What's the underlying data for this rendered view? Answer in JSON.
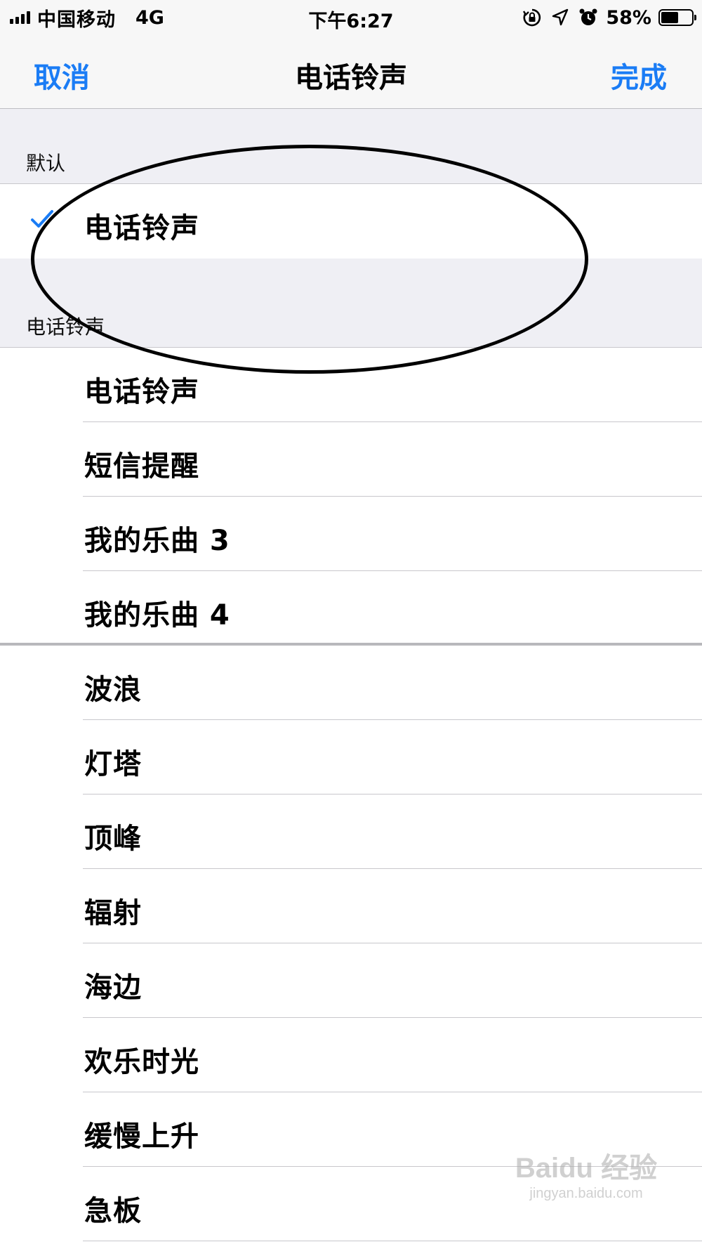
{
  "status_bar": {
    "carrier": "中国移动",
    "network": "4G",
    "time": "下午6:27",
    "battery_percent": "58%",
    "battery_level": 0.58,
    "icons": [
      "signal-icon",
      "rotation-lock-icon",
      "location-icon",
      "alarm-icon",
      "battery-icon"
    ]
  },
  "nav": {
    "cancel_label": "取消",
    "title": "电话铃声",
    "done_label": "完成"
  },
  "sections": {
    "default_header": "默认",
    "ringtones_header": "电话铃声"
  },
  "default_items": [
    {
      "label": "电话铃声",
      "selected": true
    }
  ],
  "ringtones": [
    {
      "label": "电话铃声"
    },
    {
      "label": "短信提醒"
    },
    {
      "label": "我的乐曲 3"
    },
    {
      "label": "我的乐曲 4"
    },
    {
      "label": "波浪"
    },
    {
      "label": "灯塔"
    },
    {
      "label": "顶峰"
    },
    {
      "label": "辐射"
    },
    {
      "label": "海边"
    },
    {
      "label": "欢乐时光"
    },
    {
      "label": "缓慢上升"
    },
    {
      "label": "急板"
    }
  ],
  "watermark": {
    "logo": "Baidu 经验",
    "url": "jingyan.baidu.com"
  },
  "colors": {
    "accent": "#1a7cf5",
    "grouped_background": "#efeff4",
    "separator": "#c8c7cc"
  }
}
